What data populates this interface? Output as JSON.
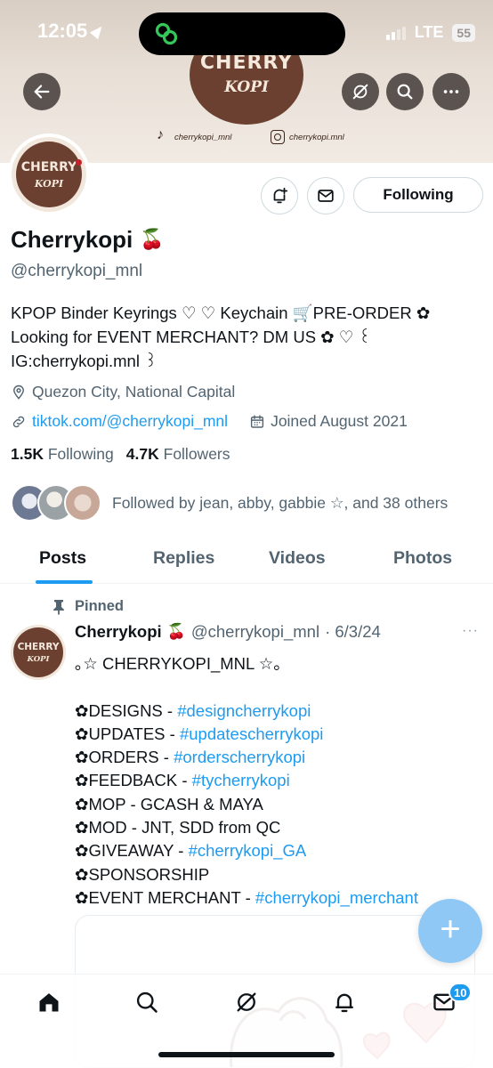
{
  "status_bar": {
    "time": "12:05",
    "network": "LTE",
    "battery": "55"
  },
  "banner": {
    "logo_title": "CHERRY",
    "logo_subtitle": "KOPI",
    "tiktok_handle": "cherrykopi_mnl",
    "instagram_handle": "cherrykopi.mnl"
  },
  "profile": {
    "avatar_title": "CHERRY",
    "avatar_subtitle": "KOPI",
    "following_button": "Following",
    "display_name": "Cherrykopi",
    "name_emoji": "🍒",
    "handle": "@cherrykopi_mnl",
    "bio_lines": [
      "KPOP Binder Keyrings ♡ ♡ Keychain 🛒PRE-ORDER ✿",
      "Looking for EVENT MERCHANT? DM US ✿ ♡ ꒰",
      "IG:cherrykopi.mnl ꒱"
    ],
    "location": "Quezon City, National Capital",
    "website": "tiktok.com/@cherrykopi_mnl",
    "joined": "Joined August 2021",
    "following_count": "1.5K",
    "following_label": "Following",
    "followers_count": "4.7K",
    "followers_label": "Followers",
    "followed_by": "Followed by jean, abby, gabbie ☆, and 38 others"
  },
  "tabs": [
    "Posts",
    "Replies",
    "Videos",
    "Photos"
  ],
  "pinned_post": {
    "pinned_label": "Pinned",
    "avatar_title": "CHERRY",
    "avatar_subtitle": "KOPI",
    "author_name": "Cherrykopi",
    "author_emoji": "🍒",
    "author_handle": "@cherrykopi_mnl",
    "date": "· 6/3/24",
    "more": "···",
    "headline": "｡☆ CHERRYKOPI_MNL ☆｡",
    "lines": [
      {
        "text": "✿DESIGNS - ",
        "tag": "#designcherrykopi"
      },
      {
        "text": "✿UPDATES - ",
        "tag": "#updatescherrykopi"
      },
      {
        "text": "✿ORDERS - ",
        "tag": "#orderscherrykopi"
      },
      {
        "text": "✿FEEDBACK - ",
        "tag": "#tycherrykopi"
      },
      {
        "text": "✿MOP - GCASH & MAYA",
        "tag": ""
      },
      {
        "text": "✿MOD - JNT, SDD from QC",
        "tag": ""
      },
      {
        "text": "✿GIVEAWAY - ",
        "tag": "#cherrykopi_GA"
      },
      {
        "text": "✿SPONSORSHIP",
        "tag": ""
      },
      {
        "text": "✿EVENT MERCHANT - ",
        "tag": "#cherrykopi_merchant"
      }
    ]
  },
  "fab_label": "+",
  "bottom_nav": {
    "items": [
      "home-icon",
      "search-icon",
      "grok-icon",
      "notifications-icon",
      "messages-icon"
    ],
    "messages_badge": "10"
  },
  "colors": {
    "accent": "#1d9bf0",
    "text": "#0f1419",
    "secondary": "#536471",
    "brand_brown": "#6b4030"
  }
}
